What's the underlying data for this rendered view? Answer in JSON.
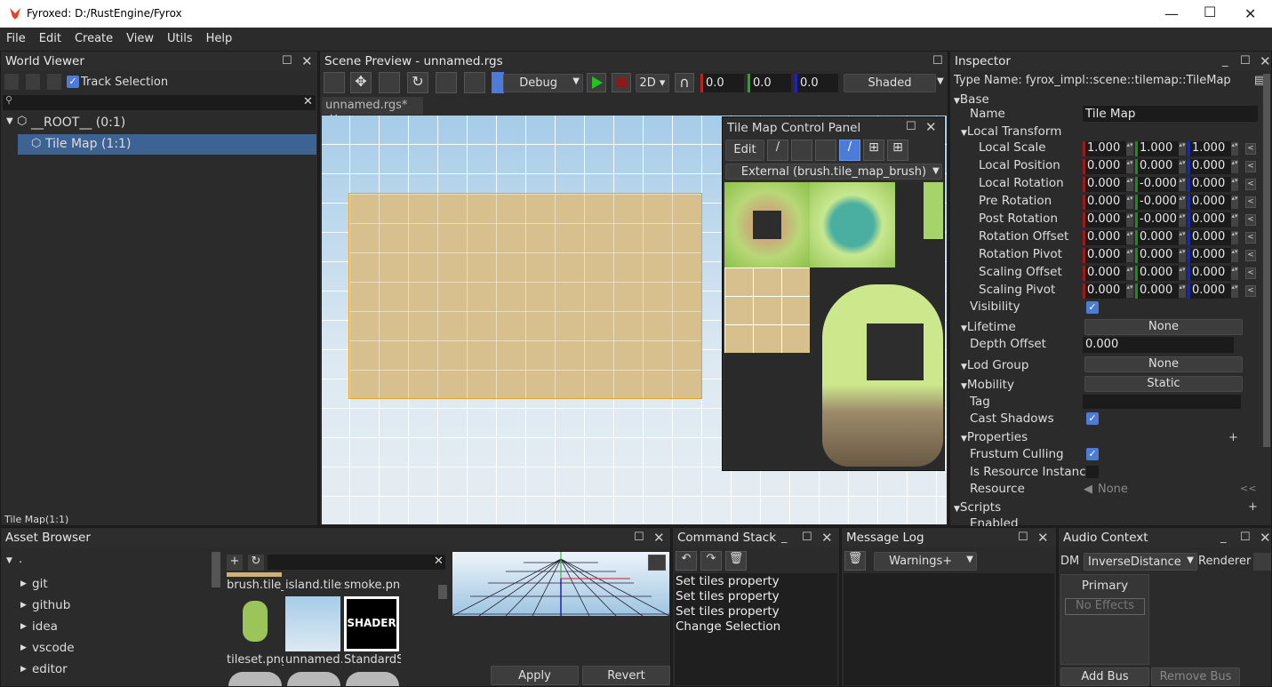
{
  "window": {
    "title": "Fyroxed: D:/RustEngine/Fyrox",
    "minimize": "—",
    "maximize": "☐",
    "close": "✕"
  },
  "menu": [
    "File",
    "Edit",
    "Create",
    "View",
    "Utils",
    "Help"
  ],
  "world_viewer": {
    "title": "World Viewer",
    "track_selection": "Track Selection",
    "tree": [
      {
        "label": "__ROOT__ (0:1)"
      },
      {
        "label": "Tile Map (1:1)"
      }
    ],
    "status": "Tile Map(1:1)"
  },
  "scene_preview": {
    "title": "Scene Preview - unnamed.rgs",
    "debug": "Debug",
    "mode2d": "2D",
    "coord_x": "0.0",
    "coord_y": "0.0",
    "coord_z": "0.0",
    "shading": "Shaded",
    "tab": "unnamed.rgs*"
  },
  "tile_panel": {
    "title": "Tile Map Control Panel",
    "edit": "Edit",
    "brush": "External (brush.tile_map_brush)"
  },
  "inspector": {
    "title": "Inspector",
    "type_name": "Type Name: fyrox_impl::scene::tilemap::TileMap",
    "base": "Base",
    "name_label": "Name",
    "name_value": "Tile Map",
    "local_transform": "Local Transform",
    "vectors": [
      {
        "label": "Local Scale",
        "v": [
          "1.000",
          "1.000",
          "1.000"
        ]
      },
      {
        "label": "Local Position",
        "v": [
          "0.000",
          "0.000",
          "0.000"
        ]
      },
      {
        "label": "Local Rotation",
        "v": [
          "0.000",
          "-0.000",
          "0.000"
        ]
      },
      {
        "label": "Pre Rotation",
        "v": [
          "0.000",
          "-0.000",
          "0.000"
        ]
      },
      {
        "label": "Post Rotation",
        "v": [
          "0.000",
          "-0.000",
          "0.000"
        ]
      },
      {
        "label": "Rotation Offset",
        "v": [
          "0.000",
          "0.000",
          "0.000"
        ]
      },
      {
        "label": "Rotation Pivot",
        "v": [
          "0.000",
          "0.000",
          "0.000"
        ]
      },
      {
        "label": "Scaling Offset",
        "v": [
          "0.000",
          "0.000",
          "0.000"
        ]
      },
      {
        "label": "Scaling Pivot",
        "v": [
          "0.000",
          "0.000",
          "0.000"
        ]
      }
    ],
    "visibility": "Visibility",
    "lifetime": "Lifetime",
    "lifetime_value": "None",
    "depth_offset": "Depth Offset",
    "depth_value": "0.000",
    "lod_group": "Lod Group",
    "lod_value": "None",
    "mobility": "Mobility",
    "mobility_value": "Static",
    "tag": "Tag",
    "cast_shadows": "Cast Shadows",
    "properties": "Properties",
    "frustum_culling": "Frustum Culling",
    "is_resource_instance": "Is Resource Instanc",
    "resource": "Resource",
    "resource_value": "None",
    "scripts": "Scripts",
    "enabled": "Enabled"
  },
  "asset_browser": {
    "title": "Asset Browser",
    "folders": [
      ".",
      "git",
      "github",
      "idea",
      "vscode",
      "editor"
    ],
    "files": [
      "brush.tile_",
      "island.tiles",
      "smoke.png",
      "tileset.png",
      "unnamed.",
      "StandardS"
    ],
    "shader_label": "SHADER",
    "apply": "Apply",
    "revert": "Revert"
  },
  "command_stack": {
    "title": "Command Stack",
    "items": [
      "Set tiles property",
      "Set tiles property",
      "Set tiles property",
      "Change Selection"
    ]
  },
  "message_log": {
    "title": "Message Log",
    "filter": "Warnings+"
  },
  "audio_context": {
    "title": "Audio Context",
    "dm_label": "DM",
    "dm_value": "InverseDistance",
    "renderer_label": "Renderer",
    "bus": "Primary",
    "no_effects": "No Effects",
    "add_bus": "Add Bus",
    "remove_bus": "Remove Bus"
  }
}
